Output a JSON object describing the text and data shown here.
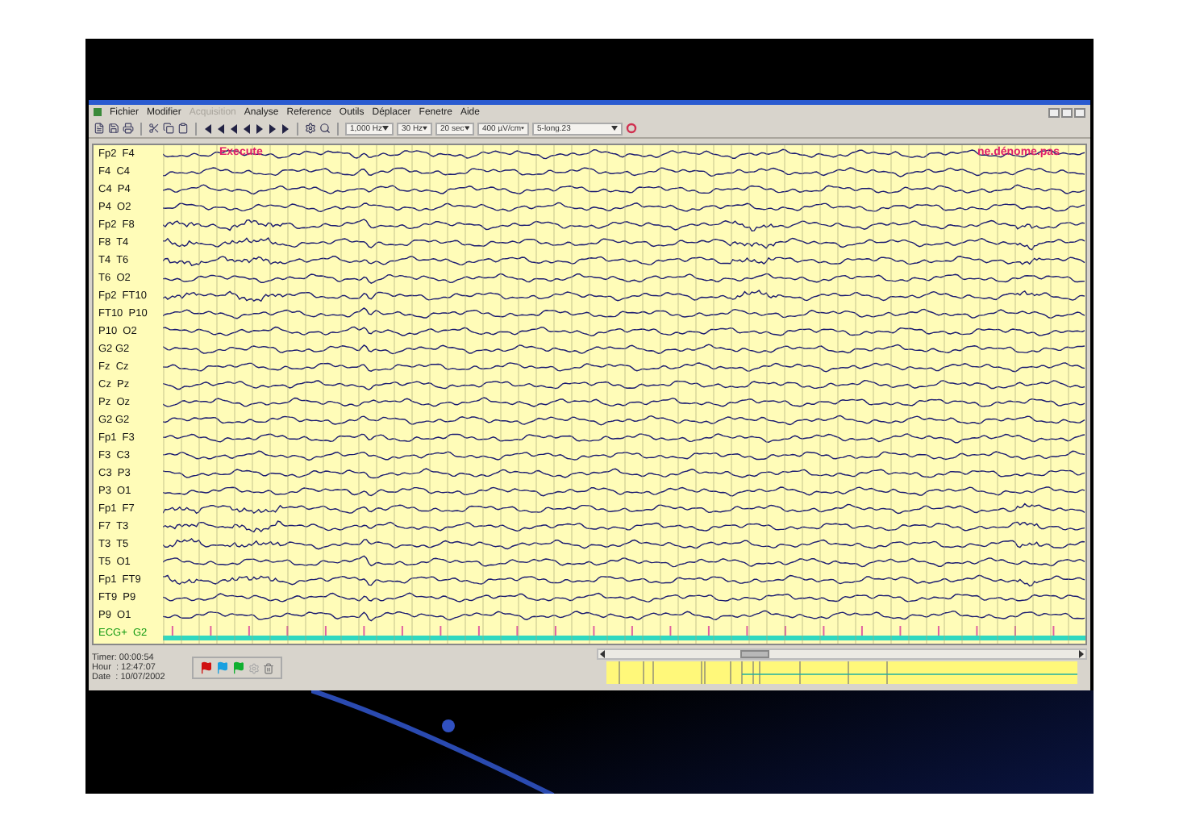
{
  "menu": [
    {
      "label": "Fichier",
      "disabled": false
    },
    {
      "label": "Modifier",
      "disabled": false
    },
    {
      "label": "Acquisition",
      "disabled": true
    },
    {
      "label": "Analyse",
      "disabled": false
    },
    {
      "label": "Reference",
      "disabled": false
    },
    {
      "label": "Outils",
      "disabled": false
    },
    {
      "label": "Déplacer",
      "disabled": false
    },
    {
      "label": "Fenetre",
      "disabled": false
    },
    {
      "label": "Aide",
      "disabled": false
    }
  ],
  "toolbar": {
    "dropdowns": [
      "1,000 Hz",
      "30 Hz",
      "20 sec",
      "400 µV/cm",
      "5-long.23"
    ]
  },
  "channels": [
    {
      "label": "Fp2  F4",
      "kind": "eeg"
    },
    {
      "label": "F4  C4",
      "kind": "eeg"
    },
    {
      "label": "C4  P4",
      "kind": "eeg"
    },
    {
      "label": "P4  O2",
      "kind": "eeg"
    },
    {
      "label": "Fp2  F8",
      "kind": "eeg"
    },
    {
      "label": "F8  T4",
      "kind": "eeg"
    },
    {
      "label": "T4  T6",
      "kind": "eeg"
    },
    {
      "label": "T6  O2",
      "kind": "eeg"
    },
    {
      "label": "Fp2  FT10",
      "kind": "eeg"
    },
    {
      "label": "FT10  P10",
      "kind": "eeg"
    },
    {
      "label": "P10  O2",
      "kind": "eeg"
    },
    {
      "label": "G2 G2",
      "kind": "eeg"
    },
    {
      "label": "Fz  Cz",
      "kind": "eeg"
    },
    {
      "label": "Cz  Pz",
      "kind": "eeg"
    },
    {
      "label": "Pz  Oz",
      "kind": "eeg"
    },
    {
      "label": "G2 G2",
      "kind": "eeg"
    },
    {
      "label": "Fp1  F3",
      "kind": "eeg"
    },
    {
      "label": "F3  C3",
      "kind": "eeg"
    },
    {
      "label": "C3  P3",
      "kind": "eeg"
    },
    {
      "label": "P3  O1",
      "kind": "eeg"
    },
    {
      "label": "Fp1  F7",
      "kind": "eeg"
    },
    {
      "label": "F7  T3",
      "kind": "eeg"
    },
    {
      "label": "T3  T5",
      "kind": "eeg"
    },
    {
      "label": "T5  O1",
      "kind": "eeg"
    },
    {
      "label": "Fp1  FT9",
      "kind": "eeg"
    },
    {
      "label": "FT9  P9",
      "kind": "eeg"
    },
    {
      "label": "P9  O1",
      "kind": "eeg"
    },
    {
      "label": "ECG+  G2",
      "kind": "ecg"
    }
  ],
  "annotations": [
    {
      "text": "Execute"
    },
    {
      "text": "ne.dénome.pas"
    }
  ],
  "status": {
    "timer": "Timer: 00:00:54",
    "hour": "Hour  : 12:47:07",
    "date": "Date  : 10/07/2002"
  }
}
